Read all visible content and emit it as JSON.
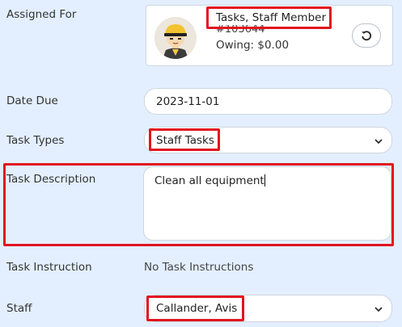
{
  "labels": {
    "assigned_for": "Assigned For",
    "date_due": "Date Due",
    "task_types": "Task Types",
    "task_description": "Task Description",
    "task_instruction": "Task Instruction",
    "staff": "Staff"
  },
  "assigned": {
    "name": "Tasks, Staff Member",
    "id": "#103644",
    "owing": "Owing: $0.00",
    "avatar_icon": "person-with-hardhat-avatar",
    "reset_icon": "reset-icon"
  },
  "date_due": {
    "value": "2023-11-01"
  },
  "task_types": {
    "selected": "Staff Tasks"
  },
  "task_description": {
    "value": "Clean all equipment"
  },
  "task_instruction": {
    "text": "No Task Instructions"
  },
  "staff": {
    "selected": "Callander, Avis"
  },
  "colors": {
    "background": "#e3efff",
    "highlight": "#e2131f"
  }
}
